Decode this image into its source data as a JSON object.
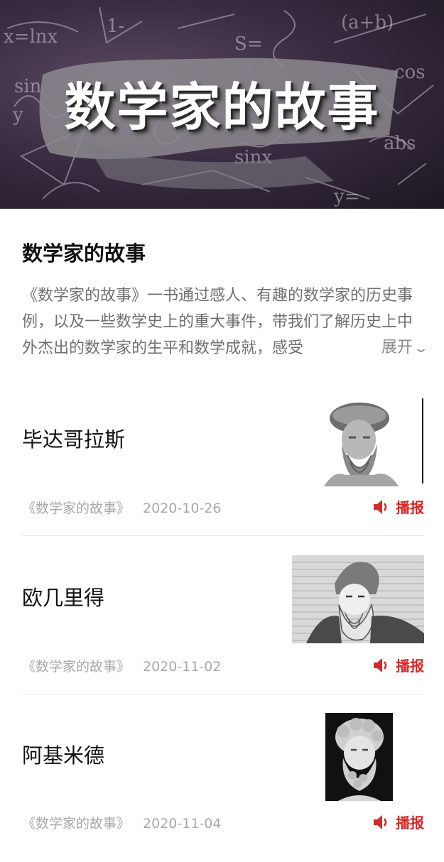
{
  "hero": {
    "title": "数学家的故事"
  },
  "intro": {
    "title": "数学家的故事",
    "description": "《数学家的故事》一书通过感人、有趣的数学家的历史事例，以及一些数学史上的重大事件，带我们了解历史上中外杰出的数学家的生平和数学成就，感受",
    "expand_label": "展开"
  },
  "articles": [
    {
      "name": "毕达哥拉斯",
      "source": "《数学家的故事》",
      "date": "2020-10-26",
      "report_label": "播报",
      "image": "pythagoras-bust"
    },
    {
      "name": "欧几里得",
      "source": "《数学家的故事》",
      "date": "2020-11-02",
      "report_label": "播报",
      "image": "euclid-engraving"
    },
    {
      "name": "阿基米德",
      "source": "《数学家的故事》",
      "date": "2020-11-04",
      "report_label": "播报",
      "image": "archimedes-bust"
    }
  ],
  "colors": {
    "accent": "#d42a2a",
    "meta": "#a8a8a8",
    "desc": "#707070"
  },
  "icons": {
    "report": "speaker-icon",
    "expand": "chevron-down-icon"
  }
}
